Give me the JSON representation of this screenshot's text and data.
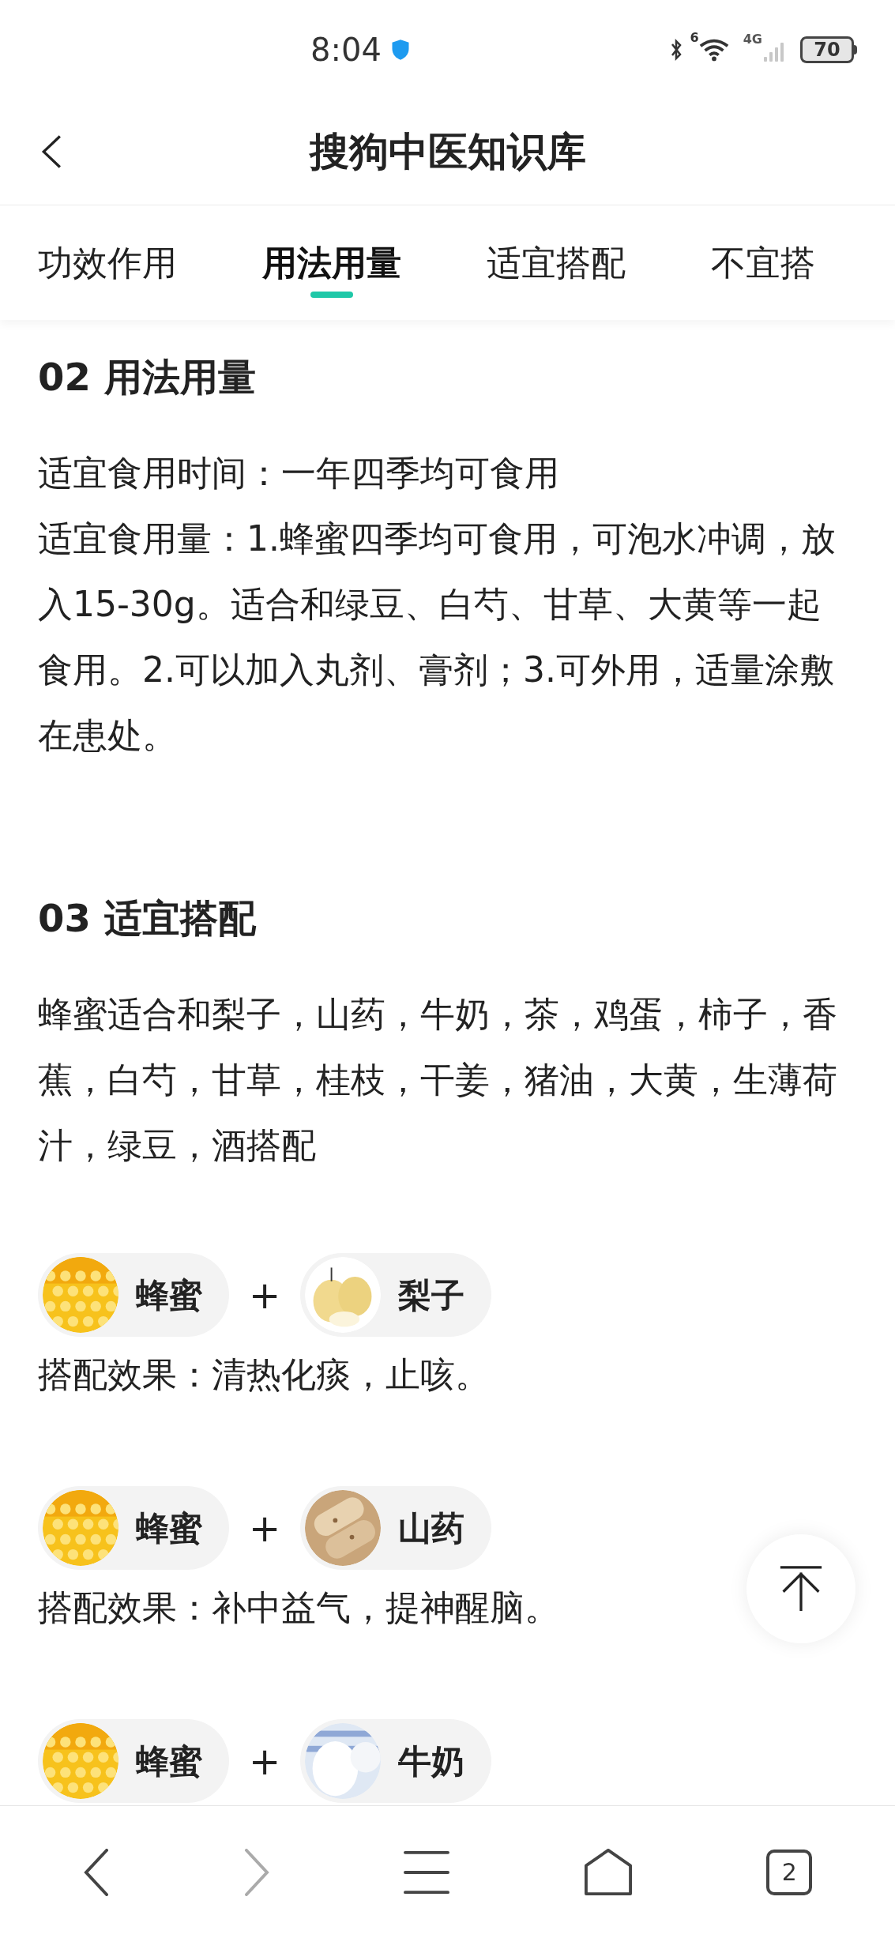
{
  "status_bar": {
    "time": "8:04",
    "signal_label": "4G",
    "wifi_label": "6",
    "battery": "70"
  },
  "header": {
    "title": "搜狗中医知识库"
  },
  "tabs": [
    {
      "label": "功效作用",
      "selected": false
    },
    {
      "label": "用法用量",
      "selected": true
    },
    {
      "label": "适宜搭配",
      "selected": false
    },
    {
      "label": "不宜搭",
      "selected": false
    }
  ],
  "sections": [
    {
      "heading": "02 用法用量",
      "paragraphs": [
        "适宜食用时间：一年四季均可食用",
        "适宜食用量：1.蜂蜜四季均可食用，可泡水冲调，放入15-30g。适合和绿豆、白芍、甘草、大黄等一起食用。2.可以加入丸剂、膏剂；3.可外用，适量涂敷在患处。"
      ]
    },
    {
      "heading": "03 适宜搭配",
      "paragraphs": [
        "蜂蜜适合和梨子，山药，牛奶，茶，鸡蛋，柿子，香蕉，白芍，甘草，桂枝，干姜，猪油，大黄，生薄荷汁，绿豆，酒搭配"
      ],
      "pairs": [
        {
          "items": [
            "蜂蜜",
            "梨子"
          ],
          "operator": "+",
          "effect": "搭配效果：清热化痰，止咳。"
        },
        {
          "items": [
            "蜂蜜",
            "山药"
          ],
          "operator": "+",
          "effect": "搭配效果：补中益气，提神醒脑。"
        },
        {
          "items": [
            "蜂蜜",
            "牛奶"
          ],
          "operator": "+"
        }
      ]
    }
  ],
  "bottom_nav": {
    "tab_count": "2"
  }
}
